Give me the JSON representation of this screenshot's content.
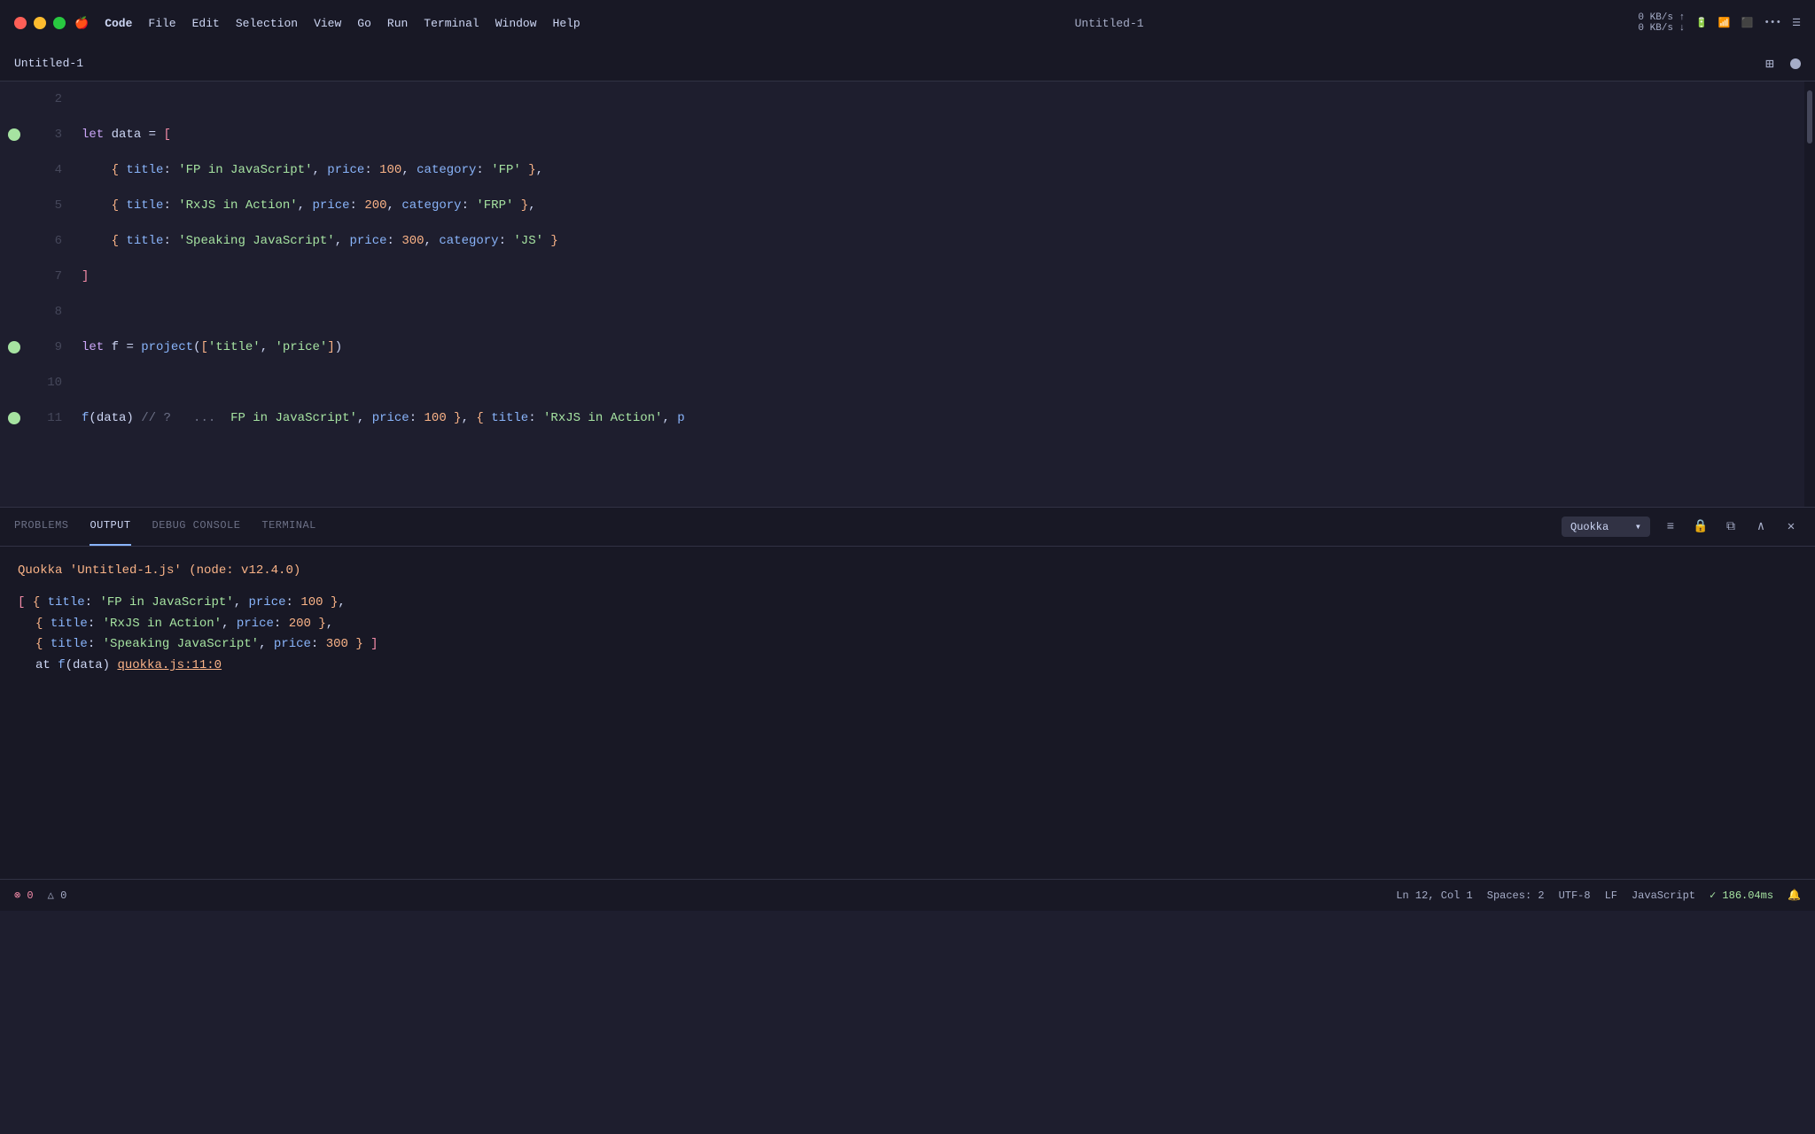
{
  "window": {
    "title": "Untitled-1",
    "tab_title": "Untitled-1"
  },
  "macos_menu": {
    "apple": "🍎",
    "items": [
      "Code",
      "File",
      "Edit",
      "Selection",
      "View",
      "Go",
      "Run",
      "Terminal",
      "Window",
      "Help"
    ]
  },
  "system_tray": {
    "network": "0 KB/s ↑  0 KB/s ↓",
    "battery": "🔋",
    "wifi": "WiFi",
    "time": ""
  },
  "editor": {
    "lines": [
      {
        "num": "2",
        "has_bp": false,
        "tokens": []
      },
      {
        "num": "3",
        "has_bp": true,
        "code": "let data = ["
      },
      {
        "num": "4",
        "has_bp": false,
        "code": "  { title: 'FP in JavaScript', price: 100, category: 'FP' },"
      },
      {
        "num": "5",
        "has_bp": false,
        "code": "  { title: 'RxJS in Action', price: 200, category: 'FRP' },"
      },
      {
        "num": "6",
        "has_bp": false,
        "code": "  { title: 'Speaking JavaScript', price: 300, category: 'JS' }"
      },
      {
        "num": "7",
        "has_bp": false,
        "code": "]"
      },
      {
        "num": "8",
        "has_bp": false,
        "code": ""
      },
      {
        "num": "9",
        "has_bp": true,
        "code": "let f = project(['title', 'price'])"
      },
      {
        "num": "10",
        "has_bp": false,
        "code": ""
      },
      {
        "num": "11",
        "has_bp": true,
        "code": "f(data) // ?   ...  FP in JavaScript', price: 100 }, { title: 'RxJS in Action', p"
      }
    ]
  },
  "panel": {
    "tabs": [
      "PROBLEMS",
      "OUTPUT",
      "DEBUG CONSOLE",
      "TERMINAL"
    ],
    "active_tab": "OUTPUT",
    "dropdown_label": "Quokka",
    "icons": {
      "list": "≡",
      "lock": "🔒",
      "copy": "⧉",
      "up": "∧",
      "close": "✕"
    },
    "output": {
      "header": "Quokka 'Untitled-1.js' (node: v12.4.0)",
      "lines": [
        "[ { title: 'FP in JavaScript', price: 100 },",
        "  { title: 'RxJS in Action', price: 200 },",
        "  { title: 'Speaking JavaScript', price: 300 } ]",
        "  at f(data) quokka.js:11:0"
      ]
    }
  },
  "statusbar": {
    "errors": "⊗ 0",
    "warnings": "△ 0",
    "position": "Ln 12, Col 1",
    "spaces": "Spaces: 2",
    "encoding": "UTF-8",
    "eol": "LF",
    "language": "JavaScript",
    "quokka_time": "✓ 186.04ms",
    "notification": "🔔"
  }
}
